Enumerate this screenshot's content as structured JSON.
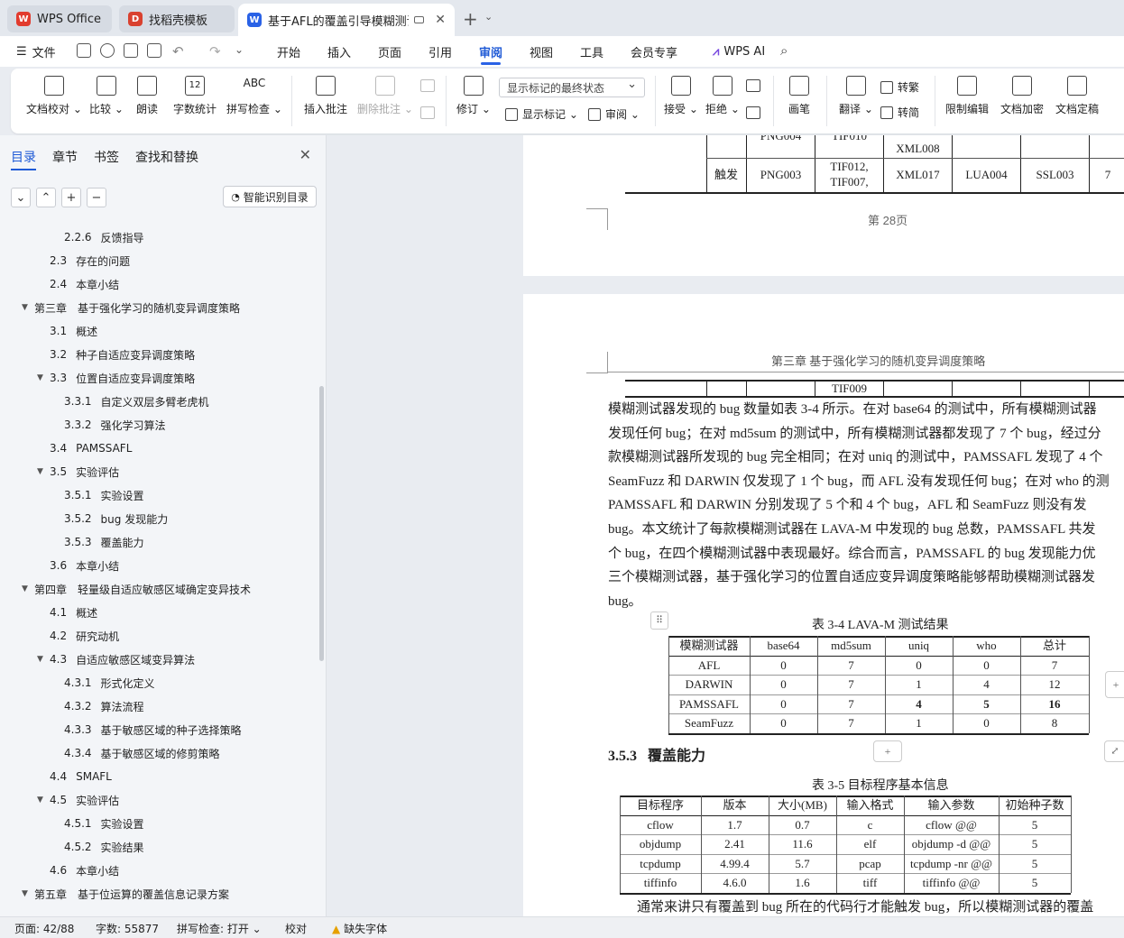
{
  "tabs": [
    {
      "label": "WPS Office",
      "icon": "wps-logo-icon"
    },
    {
      "label": "找稻壳模板",
      "icon": "docer-icon"
    },
    {
      "label": "基于AFL的覆盖引导模糊测试优",
      "icon": "word-doc-icon"
    }
  ],
  "menu": {
    "file": "文件",
    "items": [
      "开始",
      "插入",
      "页面",
      "引用",
      "审阅",
      "视图",
      "工具",
      "会员专享"
    ],
    "active": "审阅",
    "ai": "WPS AI"
  },
  "ribbon": {
    "doc_check": "文档校对",
    "compare": "比较",
    "read_aloud": "朗读",
    "word_count": "字数统计",
    "spell_check": "拼写检查",
    "spell_glyph": "ABC",
    "insert_comment": "插入批注",
    "delete_comment": "删除批注",
    "revise": "修订",
    "markup_select": "显示标记的最终状态",
    "show_markup": "显示标记",
    "review_pane": "审阅",
    "accept": "接受",
    "reject": "拒绝",
    "pen": "画笔",
    "translate": "翻译",
    "to_traditional": "转繁",
    "to_simplified": "转简",
    "restrict_edit": "限制编辑",
    "encrypt": "文档加密",
    "finalize": "文档定稿"
  },
  "panel": {
    "tabs": [
      "目录",
      "章节",
      "书签",
      "查找和替换"
    ],
    "smart_toc": "智能识别目录",
    "toc": [
      {
        "num": "2.2.6",
        "title": "反馈指导",
        "level": 3
      },
      {
        "num": "2.3",
        "title": "存在的问题",
        "level": 2
      },
      {
        "num": "2.4",
        "title": "本章小结",
        "level": 2
      },
      {
        "num": "第三章",
        "title": "基于强化学习的随机变异调度策略",
        "level": 1,
        "expanded": true
      },
      {
        "num": "3.1",
        "title": "概述",
        "level": 2
      },
      {
        "num": "3.2",
        "title": "种子自适应变异调度策略",
        "level": 2
      },
      {
        "num": "3.3",
        "title": "位置自适应变异调度策略",
        "level": 2,
        "expanded": true
      },
      {
        "num": "3.3.1",
        "title": "自定义双层多臂老虎机",
        "level": 3
      },
      {
        "num": "3.3.2",
        "title": "强化学习算法",
        "level": 3
      },
      {
        "num": "3.4",
        "title": "PAMSSAFL",
        "level": 2
      },
      {
        "num": "3.5",
        "title": "实验评估",
        "level": 2,
        "expanded": true
      },
      {
        "num": "3.5.1",
        "title": "实验设置",
        "level": 3
      },
      {
        "num": "3.5.2",
        "title": "bug 发现能力",
        "level": 3
      },
      {
        "num": "3.5.3",
        "title": "覆盖能力",
        "level": 3
      },
      {
        "num": "3.6",
        "title": "本章小结",
        "level": 2
      },
      {
        "num": "第四章",
        "title": "轻量级自适应敏感区域确定变异技术",
        "level": 1,
        "expanded": true
      },
      {
        "num": "4.1",
        "title": "概述",
        "level": 2
      },
      {
        "num": "4.2",
        "title": "研究动机",
        "level": 2
      },
      {
        "num": "4.3",
        "title": "自适应敏感区域变异算法",
        "level": 2,
        "expanded": true
      },
      {
        "num": "4.3.1",
        "title": "形式化定义",
        "level": 3
      },
      {
        "num": "4.3.2",
        "title": "算法流程",
        "level": 3
      },
      {
        "num": "4.3.3",
        "title": "基于敏感区域的种子选择策略",
        "level": 3
      },
      {
        "num": "4.3.4",
        "title": "基于敏感区域的修剪策略",
        "level": 3
      },
      {
        "num": "4.4",
        "title": "SMAFL",
        "level": 2
      },
      {
        "num": "4.5",
        "title": "实验评估",
        "level": 2,
        "expanded": true
      },
      {
        "num": "4.5.1",
        "title": "实验设置",
        "level": 3
      },
      {
        "num": "4.5.2",
        "title": "实验结果",
        "level": 3
      },
      {
        "num": "4.6",
        "title": "本章小结",
        "level": 2
      },
      {
        "num": "第五章",
        "title": "基于位运算的覆盖信息记录方案",
        "level": 1,
        "expanded": true
      }
    ]
  },
  "doc": {
    "top_table": {
      "row1": [
        "PNG004",
        "TIF010",
        "XML008"
      ],
      "row2": [
        "触发",
        "PNG003",
        "TIF012,",
        "TIF007,",
        "XML017",
        "LUA004",
        "SSL003",
        "7"
      ]
    },
    "page_label": "第 28页",
    "header": "第三章  基于强化学习的随机变异调度策略",
    "cont_row": "TIF009",
    "para_lines": [
      "模糊测试器发现的 bug 数量如表 3-4 所示。在对 base64 的测试中，所有模糊测试器",
      "发现任何 bug；在对 md5sum 的测试中，所有模糊测试器都发现了 7 个 bug，经过分",
      "款模糊测试器所发现的 bug 完全相同；在对 uniq 的测试中，PAMSSAFL 发现了 4 个",
      "SeamFuzz 和 DARWIN 仅发现了 1 个 bug，而 AFL 没有发现任何 bug；在对 who 的测",
      "PAMSSAFL 和 DARWIN 分别发现了 5 个和 4 个 bug，AFL 和 SeamFuzz 则没有发",
      "bug。本文统计了每款模糊测试器在 LAVA-M 中发现的 bug 总数，PAMSSAFL 共发",
      "个 bug，在四个模糊测试器中表现最好。综合而言，PAMSSAFL 的 bug 发现能力优",
      "三个模糊测试器，基于强化学习的位置自适应变异调度策略能够帮助模糊测试器发",
      "bug。"
    ],
    "table34": {
      "caption": "表  3-4    LAVA-M 测试结果",
      "headers": [
        "模糊测试器",
        "base64",
        "md5sum",
        "uniq",
        "who",
        "总计"
      ],
      "rows": [
        [
          "AFL",
          "0",
          "7",
          "0",
          "0",
          "7"
        ],
        [
          "DARWIN",
          "0",
          "7",
          "1",
          "4",
          "12"
        ],
        [
          "PAMSSAFL",
          "0",
          "7",
          "4",
          "5",
          "16"
        ],
        [
          "SeamFuzz",
          "0",
          "7",
          "1",
          "0",
          "8"
        ]
      ]
    },
    "section_num": "3.5.3",
    "section_title": "覆盖能力",
    "table35": {
      "caption": "表  3-5    目标程序基本信息",
      "headers": [
        "目标程序",
        "版本",
        "大小(MB)",
        "输入格式",
        "输入参数",
        "初始种子数"
      ],
      "rows": [
        [
          "cflow",
          "1.7",
          "0.7",
          "c",
          "cflow @@",
          "5"
        ],
        [
          "objdump",
          "2.41",
          "11.6",
          "elf",
          "objdump -d @@",
          "5"
        ],
        [
          "tcpdump",
          "4.99.4",
          "5.7",
          "pcap",
          "tcpdump -nr @@",
          "5"
        ],
        [
          "tiffinfo",
          "4.6.0",
          "1.6",
          "tiff",
          "tiffinfo @@",
          "5"
        ]
      ]
    },
    "last_line": "通常来讲只有覆盖到 bug 所在的代码行才能触发 bug，所以模糊测试器的覆盖"
  },
  "status": {
    "page": "页面: 42/88",
    "words": "字数: 55877",
    "spell": "拼写检查: 打开",
    "proof": "校对",
    "missing_font": "缺失字体"
  }
}
